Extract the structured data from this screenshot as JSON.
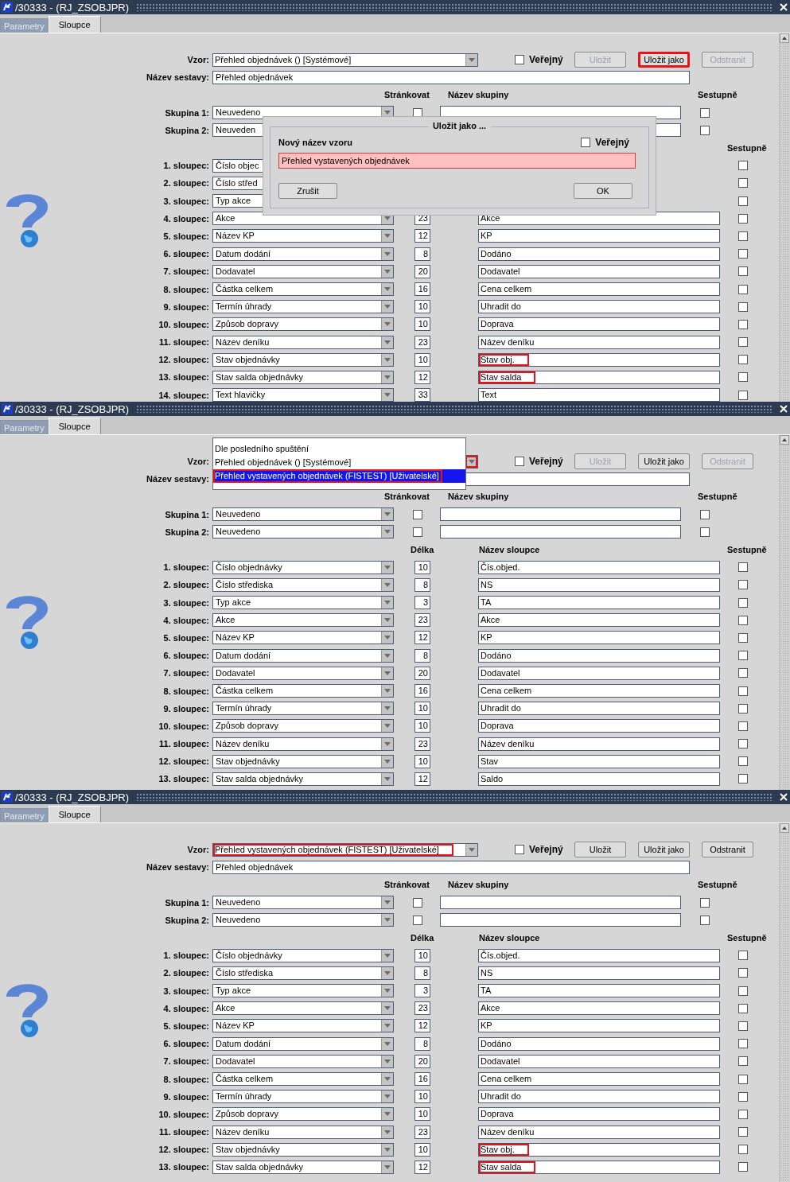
{
  "panels": [
    {
      "window": {
        "title": "/30333 - (RJ_ZSOBJPR)"
      },
      "tabs": [
        {
          "label": "Parametry",
          "selected": false
        },
        {
          "label": "Sloupce",
          "selected": true
        }
      ],
      "template": {
        "label": "Vzor:",
        "value": "Přehled objednávek   ()   [Systémové]",
        "highlighted": false,
        "arrow_highlighted": false
      },
      "public": {
        "label": "Veřejný",
        "checked": false
      },
      "buttons": [
        {
          "label": "Uložit",
          "disabled": true,
          "highlighted": false
        },
        {
          "label": "Uložit jako",
          "disabled": false,
          "highlighted": true
        },
        {
          "label": "Odstranit",
          "disabled": true,
          "highlighted": false
        }
      ],
      "report_name": {
        "label": "Název sestavy:",
        "value": "Přehled objednávek"
      },
      "group_headers": {
        "paging": "Stránkovat",
        "name": "Název skupiny",
        "descending": "Sestupně"
      },
      "groups": [
        {
          "label": "Skupina 1:",
          "value": "Neuvedeno",
          "paging": false,
          "descending": false
        },
        {
          "label": "Skupina 2:",
          "value": "Neuveden",
          "descending": false
        }
      ],
      "column_headers": {
        "descending": "Sestupně"
      },
      "columns": [
        {
          "label": "1. sloupec:",
          "value": "Číslo objec",
          "descending": false
        },
        {
          "label": "2. sloupec:",
          "value": "Číslo střed",
          "descending": false
        },
        {
          "label": "3. sloupec:",
          "value": "Typ akce",
          "descending": false
        },
        {
          "label": "4. sloupec:",
          "value": "Akce",
          "length": "23",
          "name": "Akce",
          "descending": false,
          "highlighted": false
        },
        {
          "label": "5. sloupec:",
          "value": "Název KP",
          "length": "12",
          "name": "KP",
          "descending": false,
          "highlighted": false
        },
        {
          "label": "6. sloupec:",
          "value": "Datum dodání",
          "length": "8",
          "name": "Dodáno",
          "descending": false,
          "highlighted": false
        },
        {
          "label": "7. sloupec:",
          "value": "Dodavatel",
          "length": "20",
          "name": "Dodavatel",
          "descending": false,
          "highlighted": false
        },
        {
          "label": "8. sloupec:",
          "value": "Částka celkem",
          "length": "16",
          "name": "Cena celkem",
          "descending": false,
          "highlighted": false
        },
        {
          "label": "9. sloupec:",
          "value": "Termín úhrady",
          "length": "10",
          "name": "Uhradit do",
          "descending": false,
          "highlighted": false
        },
        {
          "label": "10. sloupec:",
          "value": "Způsob dopravy",
          "length": "10",
          "name": "Doprava",
          "descending": false,
          "highlighted": false
        },
        {
          "label": "11. sloupec:",
          "value": "Název deníku",
          "length": "23",
          "name": "Název deníku",
          "descending": false,
          "highlighted": false
        },
        {
          "label": "12. sloupec:",
          "value": "Stav objednávky",
          "length": "10",
          "name": "Stav obj.",
          "descending": false,
          "highlighted": true
        },
        {
          "label": "13. sloupec:",
          "value": "Stav salda objednávky",
          "length": "12",
          "name": "Stav salda",
          "descending": false,
          "highlighted": true
        },
        {
          "label": "14. sloupec:",
          "value": "Text hlavičky",
          "length": "33",
          "name": "Text",
          "descending": false,
          "highlighted": false
        }
      ],
      "dialog": {
        "title": "Uložit jako ...",
        "label": "Nový název vzoru",
        "public": {
          "label": "Veřejný",
          "checked": false
        },
        "value": "Přehled vystavených objednávek",
        "buttons": [
          "Zrušit",
          "OK"
        ]
      }
    },
    {
      "window": {
        "title": "/30333 - (RJ_ZSOBJPR)"
      },
      "tabs": [
        {
          "label": "Parametry",
          "selected": false
        },
        {
          "label": "Sloupce",
          "selected": true
        }
      ],
      "template": {
        "label": "Vzor:",
        "arrow_highlighted": true
      },
      "public": {
        "label": "Veřejný",
        "checked": false
      },
      "buttons": [
        {
          "label": "Uložit",
          "disabled": true,
          "highlighted": false
        },
        {
          "label": "Uložit jako",
          "disabled": false,
          "highlighted": false
        },
        {
          "label": "Odstranit",
          "disabled": true,
          "highlighted": false
        }
      ],
      "report_name": {
        "label": "Název sestavy:"
      },
      "group_headers": {
        "paging": "Stránkovat",
        "name": "Název skupiny",
        "descending": "Sestupně"
      },
      "groups": [
        {
          "label": "Skupina 1:",
          "value": "Neuvedeno",
          "paging": false,
          "descending": false
        },
        {
          "label": "Skupina 2:",
          "value": "Neuvedeno",
          "paging": false,
          "descending": false
        }
      ],
      "column_headers": {
        "length": "Délka",
        "name": "Název sloupce",
        "descending": "Sestupně"
      },
      "columns": [
        {
          "label": "1. sloupec:",
          "value": "Číslo objednávky",
          "length": "10",
          "name": "Čís.objed.",
          "descending": false,
          "highlighted": false
        },
        {
          "label": "2. sloupec:",
          "value": "Číslo střediska",
          "length": "8",
          "name": "NS",
          "descending": false,
          "highlighted": false
        },
        {
          "label": "3. sloupec:",
          "value": "Typ akce",
          "length": "3",
          "name": "TA",
          "descending": false,
          "highlighted": false
        },
        {
          "label": "4. sloupec:",
          "value": "Akce",
          "length": "23",
          "name": "Akce",
          "descending": false,
          "highlighted": false
        },
        {
          "label": "5. sloupec:",
          "value": "Název KP",
          "length": "12",
          "name": "KP",
          "descending": false,
          "highlighted": false
        },
        {
          "label": "6. sloupec:",
          "value": "Datum dodání",
          "length": "8",
          "name": "Dodáno",
          "descending": false,
          "highlighted": false
        },
        {
          "label": "7. sloupec:",
          "value": "Dodavatel",
          "length": "20",
          "name": "Dodavatel",
          "descending": false,
          "highlighted": false
        },
        {
          "label": "8. sloupec:",
          "value": "Částka celkem",
          "length": "16",
          "name": "Cena celkem",
          "descending": false,
          "highlighted": false
        },
        {
          "label": "9. sloupec:",
          "value": "Termín úhrady",
          "length": "10",
          "name": "Uhradit do",
          "descending": false,
          "highlighted": false
        },
        {
          "label": "10. sloupec:",
          "value": "Způsob dopravy",
          "length": "10",
          "name": "Doprava",
          "descending": false,
          "highlighted": false
        },
        {
          "label": "11. sloupec:",
          "value": "Název deníku",
          "length": "23",
          "name": "Název deníku",
          "descending": false,
          "highlighted": false
        },
        {
          "label": "12. sloupec:",
          "value": "Stav objednávky",
          "length": "10",
          "name": "Stav",
          "descending": false,
          "highlighted": false
        },
        {
          "label": "13. sloupec:",
          "value": "Stav salda objednávky",
          "length": "12",
          "name": "Saldo",
          "descending": false,
          "highlighted": false
        }
      ],
      "dropdown": {
        "options": [
          {
            "label": "Dle posledního spuštění",
            "selected": false,
            "highlighted": false
          },
          {
            "label": "Přehled objednávek   ()   [Systémové]",
            "selected": false,
            "highlighted": false
          },
          {
            "label": "Přehled vystavených objednávek   (FISTEST)   [Uživatelské]",
            "selected": true,
            "highlighted": true
          }
        ]
      }
    },
    {
      "window": {
        "title": "/30333 - (RJ_ZSOBJPR)"
      },
      "tabs": [
        {
          "label": "Parametry",
          "selected": false
        },
        {
          "label": "Sloupce",
          "selected": true
        }
      ],
      "template": {
        "label": "Vzor:",
        "value": "Přehled vystavených objednávek   (FISTEST)   [Uživatelské]",
        "highlighted": true,
        "arrow_highlighted": false
      },
      "public": {
        "label": "Veřejný",
        "checked": false
      },
      "buttons": [
        {
          "label": "Uložit",
          "disabled": false,
          "highlighted": false
        },
        {
          "label": "Uložit jako",
          "disabled": false,
          "highlighted": false
        },
        {
          "label": "Odstranit",
          "disabled": false,
          "highlighted": false
        }
      ],
      "report_name": {
        "label": "Název sestavy:",
        "value": "Přehled objednávek"
      },
      "group_headers": {
        "paging": "Stránkovat",
        "name": "Název skupiny",
        "descending": "Sestupně"
      },
      "groups": [
        {
          "label": "Skupina 1:",
          "value": "Neuvedeno",
          "paging": false,
          "descending": false
        },
        {
          "label": "Skupina 2:",
          "value": "Neuvedeno",
          "paging": false,
          "descending": false
        }
      ],
      "column_headers": {
        "length": "Délka",
        "name": "Název sloupce",
        "descending": "Sestupně"
      },
      "columns": [
        {
          "label": "1. sloupec:",
          "value": "Číslo objednávky",
          "length": "10",
          "name": "Čís.objed.",
          "descending": false,
          "highlighted": false
        },
        {
          "label": "2. sloupec:",
          "value": "Číslo střediska",
          "length": "8",
          "name": "NS",
          "descending": false,
          "highlighted": false
        },
        {
          "label": "3. sloupec:",
          "value": "Typ akce",
          "length": "3",
          "name": "TA",
          "descending": false,
          "highlighted": false
        },
        {
          "label": "4. sloupec:",
          "value": "Akce",
          "length": "23",
          "name": "Akce",
          "descending": false,
          "highlighted": false
        },
        {
          "label": "5. sloupec:",
          "value": "Název KP",
          "length": "12",
          "name": "KP",
          "descending": false,
          "highlighted": false
        },
        {
          "label": "6. sloupec:",
          "value": "Datum dodání",
          "length": "8",
          "name": "Dodáno",
          "descending": false,
          "highlighted": false
        },
        {
          "label": "7. sloupec:",
          "value": "Dodavatel",
          "length": "20",
          "name": "Dodavatel",
          "descending": false,
          "highlighted": false
        },
        {
          "label": "8. sloupec:",
          "value": "Částka celkem",
          "length": "16",
          "name": "Cena celkem",
          "descending": false,
          "highlighted": false
        },
        {
          "label": "9. sloupec:",
          "value": "Termín úhrady",
          "length": "10",
          "name": "Uhradit do",
          "descending": false,
          "highlighted": false
        },
        {
          "label": "10. sloupec:",
          "value": "Způsob dopravy",
          "length": "10",
          "name": "Doprava",
          "descending": false,
          "highlighted": false
        },
        {
          "label": "11. sloupec:",
          "value": "Název deníku",
          "length": "23",
          "name": "Název deníku",
          "descending": false,
          "highlighted": false
        },
        {
          "label": "12. sloupec:",
          "value": "Stav objednávky",
          "length": "10",
          "name": "Stav obj.",
          "descending": false,
          "highlighted": true
        },
        {
          "label": "13. sloupec:",
          "value": "Stav salda objednávky",
          "length": "12",
          "name": "Stav salda",
          "descending": false,
          "highlighted": true
        }
      ]
    }
  ]
}
